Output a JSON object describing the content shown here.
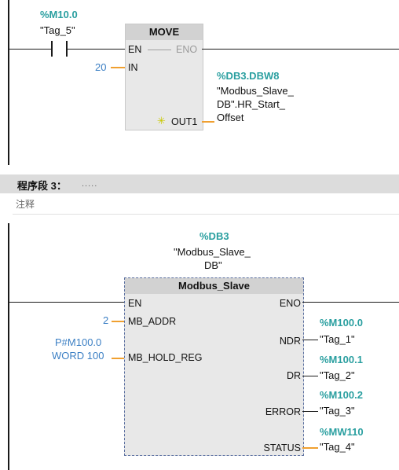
{
  "network2": {
    "contact": {
      "address": "%M10.0",
      "tag": "\"Tag_5\""
    },
    "move_block": {
      "title": "MOVE",
      "en": "EN",
      "eno": "ENO",
      "in_pin": "IN",
      "out_pin": "OUT1",
      "in_value": "20",
      "out_address": "%DB3.DBW8",
      "out_tag_line1": "\"Modbus_Slave_",
      "out_tag_line2": "DB\".HR_Start_",
      "out_tag_line3": "Offset"
    }
  },
  "segment": {
    "label": "程序段 3：",
    "dots": ".....",
    "comment_placeholder": "注释"
  },
  "network3": {
    "instance_db": {
      "address": "%DB3",
      "name_line1": "\"Modbus_Slave_",
      "name_line2": "DB\""
    },
    "block": {
      "title": "Modbus_Slave",
      "en": "EN",
      "eno": "ENO",
      "mb_addr": "MB_ADDR",
      "mb_hold_reg": "MB_HOLD_REG",
      "ndr": "NDR",
      "dr": "DR",
      "error": "ERROR",
      "status": "STATUS"
    },
    "inputs": {
      "mb_addr_value": "2",
      "hold_reg_line1": "P#M100.0",
      "hold_reg_line2": "WORD 100"
    },
    "outputs": [
      {
        "address": "%M100.0",
        "tag": "\"Tag_1\""
      },
      {
        "address": "%M100.1",
        "tag": "\"Tag_2\""
      },
      {
        "address": "%M100.2",
        "tag": "\"Tag_3\""
      },
      {
        "address": "%MW110",
        "tag": "\"Tag_4\""
      }
    ]
  }
}
